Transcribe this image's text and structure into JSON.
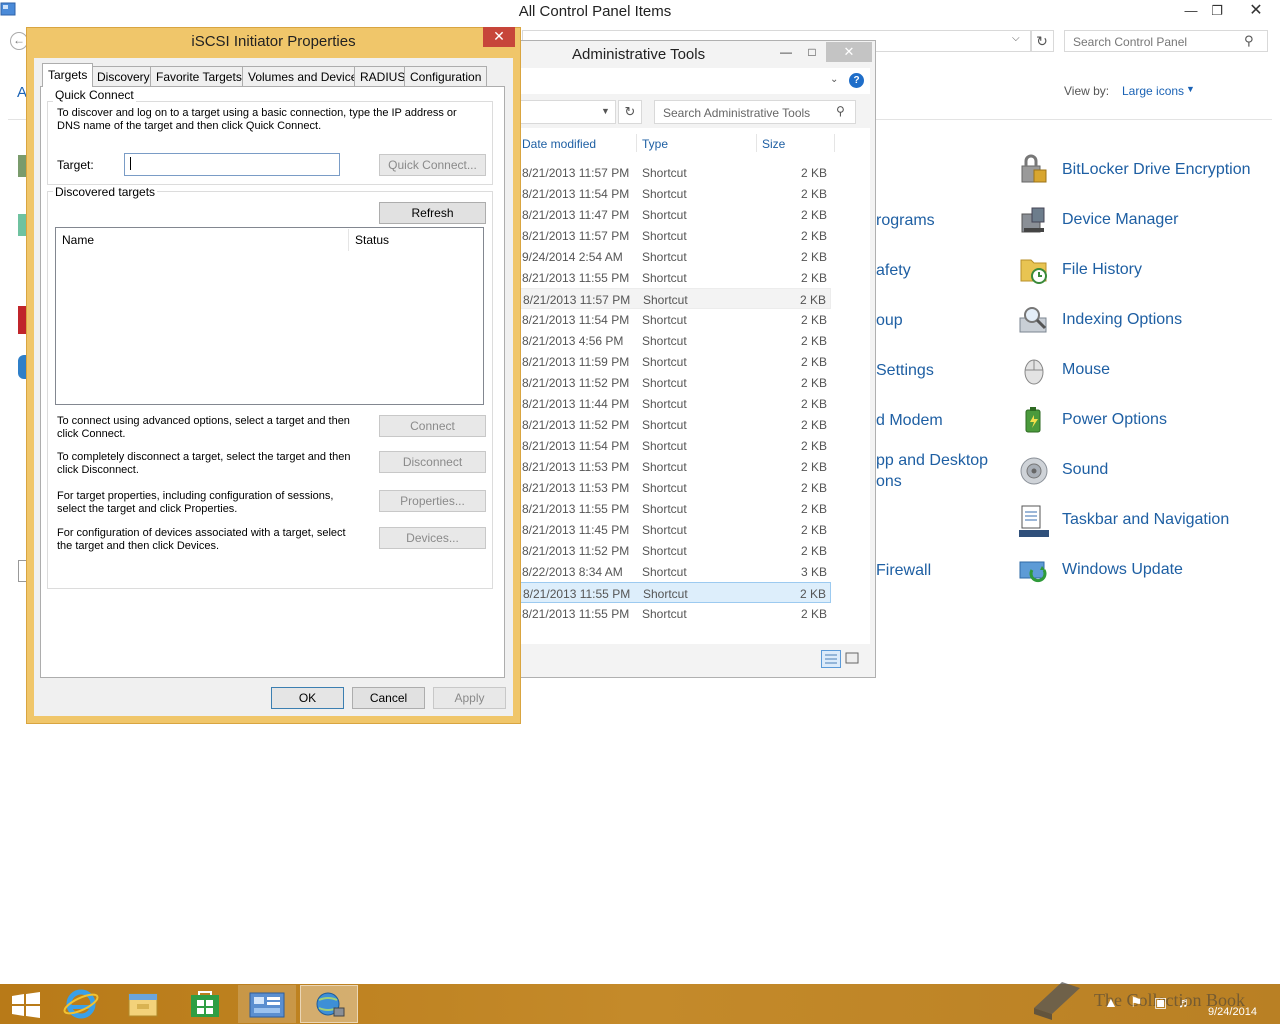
{
  "control_panel": {
    "title": "All Control Panel Items",
    "search_placeholder": "Search Control Panel",
    "view_by_label": "View by:",
    "view_by_value": "Large icons",
    "left_fragment": "A",
    "items_right": [
      {
        "label": "BitLocker Drive Encryption",
        "icon": "bitlocker-icon"
      },
      {
        "label": "Device Manager",
        "icon": "device-manager-icon"
      },
      {
        "label": "File History",
        "icon": "file-history-icon"
      },
      {
        "label": "Indexing Options",
        "icon": "indexing-options-icon"
      },
      {
        "label": "Mouse",
        "icon": "mouse-icon"
      },
      {
        "label": "Power Options",
        "icon": "power-options-icon"
      },
      {
        "label": "Sound",
        "icon": "sound-icon"
      },
      {
        "label": "Taskbar and Navigation",
        "icon": "taskbar-navigation-icon"
      },
      {
        "label": "Windows Update",
        "icon": "windows-update-icon"
      }
    ],
    "items_partial": [
      "rograms",
      "afety",
      "oup",
      "Settings",
      "d Modem",
      "pp and Desktop",
      "ons",
      "Firewall"
    ]
  },
  "admin_tools": {
    "title": "Administrative Tools",
    "search_placeholder": "Search Administrative Tools",
    "columns": {
      "date": "Date modified",
      "type": "Type",
      "size": "Size"
    },
    "rows": [
      {
        "date": "8/21/2013 11:57 PM",
        "type": "Shortcut",
        "size": "2 KB"
      },
      {
        "date": "8/21/2013 11:54 PM",
        "type": "Shortcut",
        "size": "2 KB"
      },
      {
        "date": "8/21/2013 11:47 PM",
        "type": "Shortcut",
        "size": "2 KB"
      },
      {
        "date": "8/21/2013 11:57 PM",
        "type": "Shortcut",
        "size": "2 KB"
      },
      {
        "date": "9/24/2014 2:54 AM",
        "type": "Shortcut",
        "size": "2 KB"
      },
      {
        "date": "8/21/2013 11:55 PM",
        "type": "Shortcut",
        "size": "2 KB"
      },
      {
        "date": "8/21/2013 11:57 PM",
        "type": "Shortcut",
        "size": "2 KB"
      },
      {
        "date": "8/21/2013 11:54 PM",
        "type": "Shortcut",
        "size": "2 KB"
      },
      {
        "date": "8/21/2013 4:56 PM",
        "type": "Shortcut",
        "size": "2 KB"
      },
      {
        "date": "8/21/2013 11:59 PM",
        "type": "Shortcut",
        "size": "2 KB"
      },
      {
        "date": "8/21/2013 11:52 PM",
        "type": "Shortcut",
        "size": "2 KB"
      },
      {
        "date": "8/21/2013 11:44 PM",
        "type": "Shortcut",
        "size": "2 KB"
      },
      {
        "date": "8/21/2013 11:52 PM",
        "type": "Shortcut",
        "size": "2 KB"
      },
      {
        "date": "8/21/2013 11:54 PM",
        "type": "Shortcut",
        "size": "2 KB"
      },
      {
        "date": "8/21/2013 11:53 PM",
        "type": "Shortcut",
        "size": "2 KB"
      },
      {
        "date": "8/21/2013 11:53 PM",
        "type": "Shortcut",
        "size": "2 KB"
      },
      {
        "date": "8/21/2013 11:55 PM",
        "type": "Shortcut",
        "size": "2 KB"
      },
      {
        "date": "8/21/2013 11:45 PM",
        "type": "Shortcut",
        "size": "2 KB"
      },
      {
        "date": "8/21/2013 11:52 PM",
        "type": "Shortcut",
        "size": "2 KB"
      },
      {
        "date": "8/22/2013 8:34 AM",
        "type": "Shortcut",
        "size": "3 KB"
      },
      {
        "date": "8/21/2013 11:55 PM",
        "type": "Shortcut",
        "size": "2 KB"
      },
      {
        "date": "8/21/2013 11:55 PM",
        "type": "Shortcut",
        "size": "2 KB"
      }
    ]
  },
  "iscsi": {
    "title": "iSCSI Initiator Properties",
    "tabs": [
      "Targets",
      "Discovery",
      "Favorite Targets",
      "Volumes and Devices",
      "RADIUS",
      "Configuration"
    ],
    "quick_connect": {
      "group": "Quick Connect",
      "description": "To discover and log on to a target using a basic connection, type the IP address or DNS name of the target and then click Quick Connect.",
      "target_label": "Target:",
      "target_value": "",
      "button": "Quick Connect..."
    },
    "discovered": {
      "group": "Discovered targets",
      "refresh": "Refresh",
      "col_name": "Name",
      "col_status": "Status",
      "connect_text": "To connect using advanced options, select a target and then click Connect.",
      "connect_btn": "Connect",
      "disconnect_text": "To completely disconnect a target, select the target and then click Disconnect.",
      "disconnect_btn": "Disconnect",
      "properties_text": "For target properties, including configuration of sessions, select the target and click Properties.",
      "properties_btn": "Properties...",
      "devices_text": "For configuration of devices associated with a target, select the target and then click Devices.",
      "devices_btn": "Devices..."
    },
    "buttons": {
      "ok": "OK",
      "cancel": "Cancel",
      "apply": "Apply"
    }
  },
  "taskbar": {
    "date": "9/24/2014",
    "watermark": "The Collection Book",
    "apps": [
      "start-button",
      "internet-explorer-icon",
      "file-explorer-icon",
      "store-icon",
      "control-panel-icon",
      "iscsi-initiator-icon"
    ]
  }
}
